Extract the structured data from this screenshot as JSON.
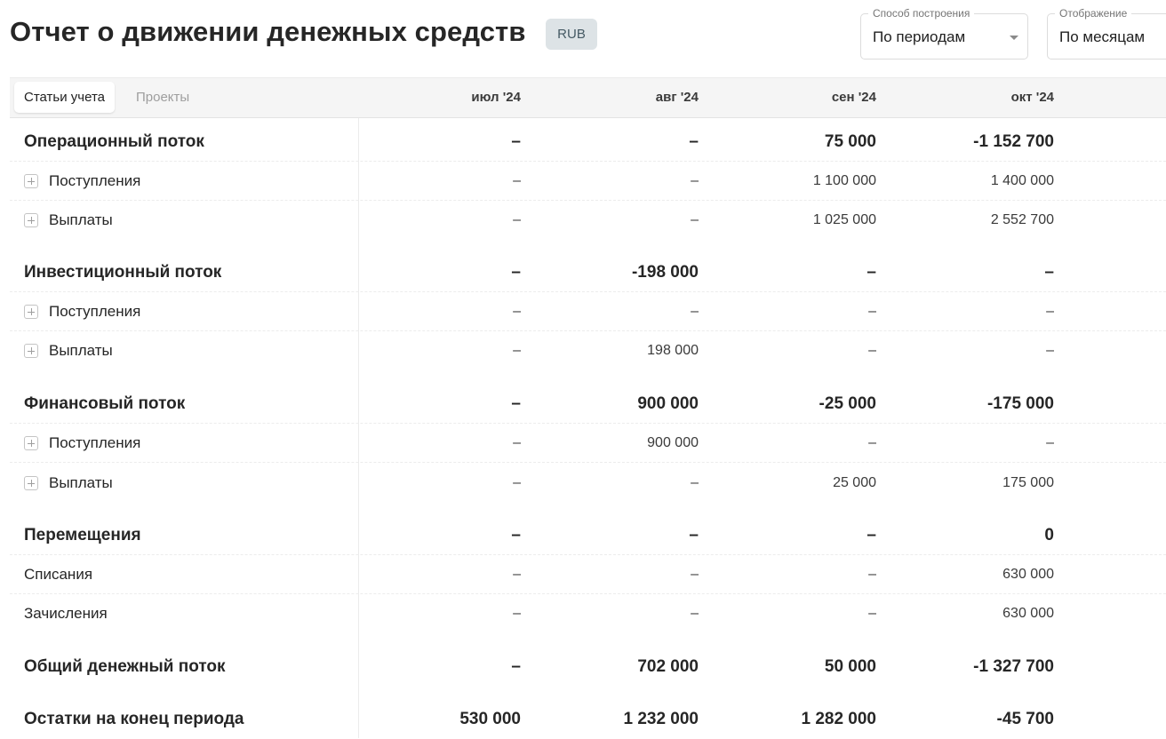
{
  "header": {
    "title": "Отчет о движении денежных средств",
    "currency": "RUB",
    "method": {
      "label": "Способ построения",
      "value": "По периодам"
    },
    "display": {
      "label": "Отображение",
      "value": "По месяцам"
    }
  },
  "tabs": [
    {
      "label": "Статьи учета",
      "active": true
    },
    {
      "label": "Проекты",
      "active": false
    }
  ],
  "columns": [
    "июл '24",
    "авг '24",
    "сен '24",
    "окт '24"
  ],
  "rows": [
    {
      "label": "Операционный поток",
      "values": [
        "–",
        "–",
        "75 000",
        "-1 152 700"
      ]
    },
    {
      "label": "Поступления",
      "values": [
        "–",
        "–",
        "1 100 000",
        "1 400 000"
      ]
    },
    {
      "label": "Выплаты",
      "values": [
        "–",
        "–",
        "1 025 000",
        "2 552 700"
      ]
    },
    {
      "label": "Инвестиционный поток",
      "values": [
        "–",
        "-198 000",
        "–",
        "–"
      ]
    },
    {
      "label": "Поступления",
      "values": [
        "–",
        "–",
        "–",
        "–"
      ]
    },
    {
      "label": "Выплаты",
      "values": [
        "–",
        "198 000",
        "–",
        "–"
      ]
    },
    {
      "label": "Финансовый поток",
      "values": [
        "–",
        "900 000",
        "-25 000",
        "-175 000"
      ]
    },
    {
      "label": "Поступления",
      "values": [
        "–",
        "900 000",
        "–",
        "–"
      ]
    },
    {
      "label": "Выплаты",
      "values": [
        "–",
        "–",
        "25 000",
        "175 000"
      ]
    },
    {
      "label": "Перемещения",
      "values": [
        "–",
        "–",
        "–",
        "0"
      ]
    },
    {
      "label": "Списания",
      "values": [
        "–",
        "–",
        "–",
        "630 000"
      ]
    },
    {
      "label": "Зачисления",
      "values": [
        "–",
        "–",
        "–",
        "630 000"
      ]
    },
    {
      "label": "Общий денежный поток",
      "values": [
        "–",
        "702 000",
        "50 000",
        "-1 327 700"
      ]
    },
    {
      "label": "Остатки на конец периода",
      "values": [
        "530 000",
        "1 232 000",
        "1 282 000",
        "-45 700"
      ]
    }
  ]
}
